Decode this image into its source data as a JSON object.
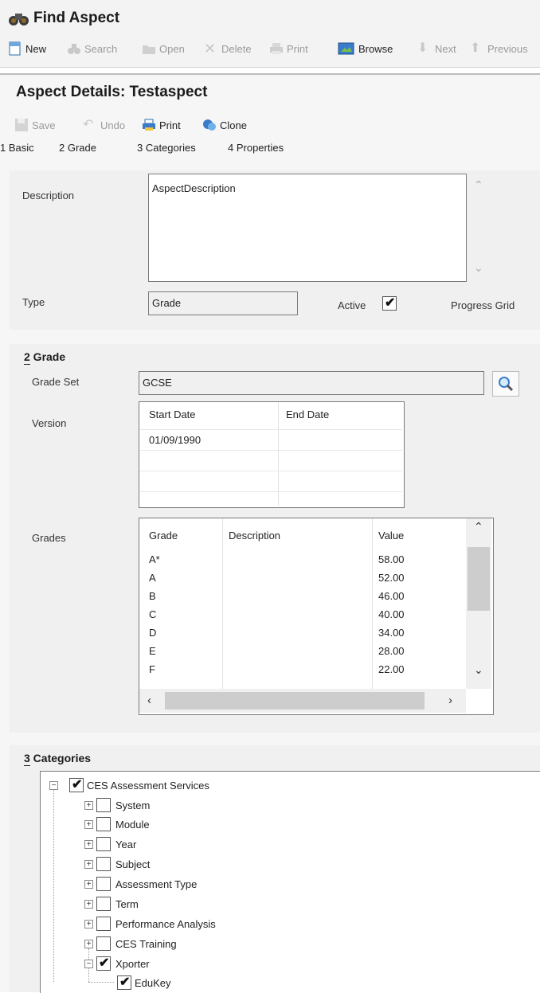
{
  "window": {
    "title": "Find Aspect"
  },
  "toolbar": {
    "new": "New",
    "search": "Search",
    "open": "Open",
    "delete": "Delete",
    "print": "Print",
    "browse": "Browse",
    "next": "Next",
    "previous": "Previous"
  },
  "details": {
    "title": "Aspect Details: Testaspect",
    "save": "Save",
    "undo": "Undo",
    "print": "Print",
    "clone": "Clone",
    "tabs": [
      "1 Basic",
      "2 Grade",
      "3 Categories",
      "4 Properties"
    ]
  },
  "basic": {
    "description_label": "Description",
    "description_value": "AspectDescription",
    "type_label": "Type",
    "type_value": "Grade",
    "active_label": "Active",
    "active_checked": true,
    "progress_grid_label": "Progress Grid"
  },
  "grade": {
    "section_title": "2 Grade",
    "grade_set_label": "Grade Set",
    "grade_set_value": "GCSE",
    "version_label": "Version",
    "version_headers": [
      "Start Date",
      "End Date"
    ],
    "version_rows": [
      [
        "01/09/1990",
        ""
      ]
    ],
    "grades_label": "Grades",
    "grades_headers": [
      "Grade",
      "Description",
      "Value"
    ],
    "grades_rows": [
      [
        "A*",
        "",
        "58.00"
      ],
      [
        "A",
        "",
        "52.00"
      ],
      [
        "B",
        "",
        "46.00"
      ],
      [
        "C",
        "",
        "40.00"
      ],
      [
        "D",
        "",
        "34.00"
      ],
      [
        "E",
        "",
        "28.00"
      ],
      [
        "F",
        "",
        "22.00"
      ]
    ]
  },
  "categories": {
    "section_title": "3 Categories",
    "root": {
      "label": "CES Assessment Services",
      "checked": true
    },
    "children": [
      {
        "label": "System",
        "checked": false
      },
      {
        "label": "Module",
        "checked": false
      },
      {
        "label": "Year",
        "checked": false
      },
      {
        "label": "Subject",
        "checked": false
      },
      {
        "label": "Assessment Type",
        "checked": false
      },
      {
        "label": "Term",
        "checked": false
      },
      {
        "label": "Performance Analysis",
        "checked": false
      },
      {
        "label": "CES Training",
        "checked": false
      },
      {
        "label": "Xporter",
        "checked": true
      }
    ],
    "grandchild": {
      "label": "EduKey",
      "checked": true
    }
  },
  "colors": {
    "panel": "#f0f0f0",
    "accent_blue": "#2b6cb0"
  }
}
